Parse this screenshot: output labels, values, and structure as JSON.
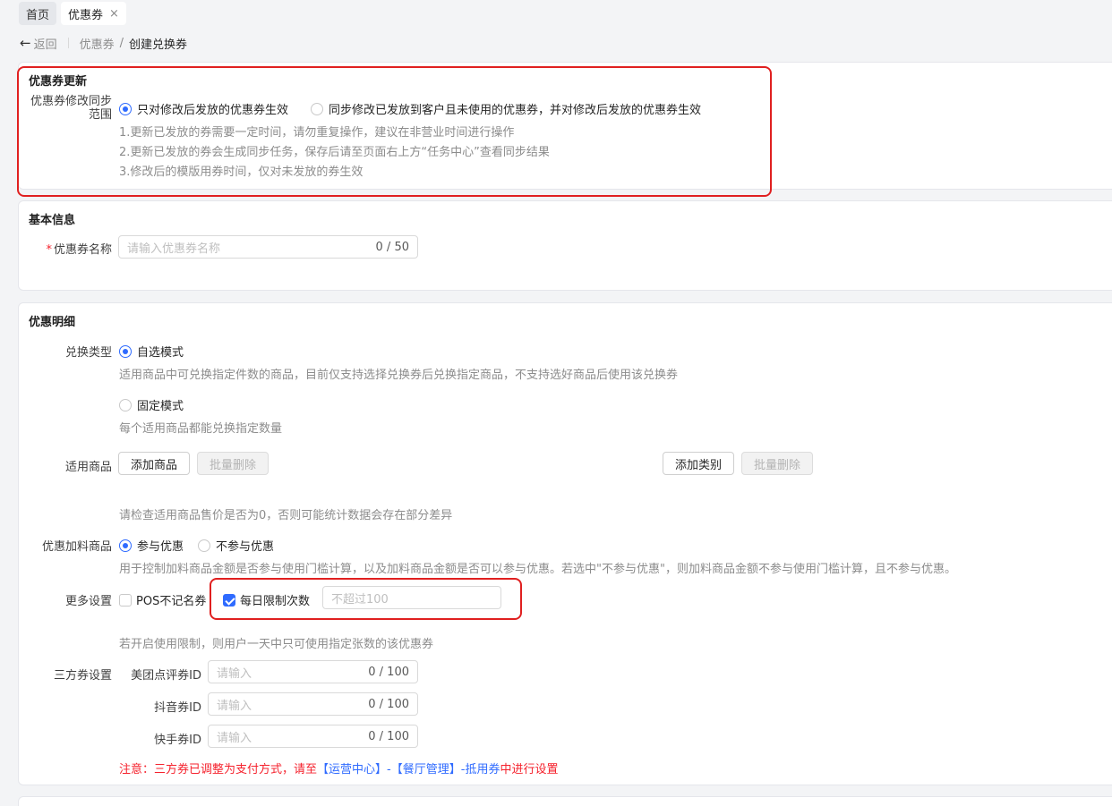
{
  "tabs": [
    {
      "label": "首页"
    },
    {
      "label": "优惠券",
      "close": "×"
    }
  ],
  "breadcrumb": {
    "back": "返回",
    "parent": "优惠券",
    "sep": "/",
    "current": "创建兑换券"
  },
  "sync": {
    "title": "优惠券更新",
    "label": "优惠券修改同步范围",
    "opt1": "只对修改后发放的优惠券生效",
    "opt2": "同步修改已发放到客户且未使用的优惠券，并对修改后发放的优惠券生效",
    "tips": [
      "1.更新已发放的券需要一定时间，请勿重复操作，建议在非营业时间进行操作",
      "2.更新已发放的券会生成同步任务，保存后请至页面右上方“任务中心”查看同步结果",
      "3.修改后的模版用券时间，仅对未发放的券生效"
    ]
  },
  "basic": {
    "title": "基本信息",
    "name_label": "优惠券名称",
    "required_mark": "*",
    "name_placeholder": "请输入优惠券名称",
    "name_count": "0 / 50"
  },
  "detail": {
    "title": "优惠明细",
    "type_label": "兑换类型",
    "type_opt1": "自选模式",
    "type_opt1_hint": "适用商品中可兑换指定件数的商品，目前仅支持选择兑换券后兑换指定商品，不支持选好商品后使用该兑换券",
    "type_opt2": "固定模式",
    "type_opt2_hint": "每个适用商品都能兑换指定数量",
    "goods_label": "适用商品",
    "add_goods": "添加商品",
    "batch_delete": "批量删除",
    "add_category": "添加类别",
    "batch_delete2": "批量删除",
    "goods_hint": "请检查适用商品售价是否为0，否则可能统计数据会存在部分差异",
    "addon_label": "优惠加料商品",
    "addon_opt1": "参与优惠",
    "addon_opt2": "不参与优惠",
    "addon_hint": "用于控制加料商品金额是否参与使用门槛计算，以及加料商品金额是否可以参与优惠。若选中\"不参与优惠\"，则加料商品金额不参与使用门槛计算，且不参与优惠。",
    "more_label": "更多设置",
    "pos_anon": "POS不记名券",
    "daily_limit": "每日限制次数",
    "daily_placeholder": "不超过100",
    "daily_hint": "若开启使用限制，则用户一天中只可使用指定张数的该优惠券",
    "third_label": "三方券设置",
    "third": [
      {
        "label": "美团点评券ID",
        "placeholder": "请输入",
        "count": "0 / 100"
      },
      {
        "label": "抖音券ID",
        "placeholder": "请输入",
        "count": "0 / 100"
      },
      {
        "label": "快手券ID",
        "placeholder": "请输入",
        "count": "0 / 100"
      }
    ],
    "notice": {
      "prefix": "注意：三方券已调整为支付方式，请至",
      "link1": "【运营中心】",
      "dash1": "-",
      "link2": "【餐厅管理】",
      "dash2": "-",
      "link3": "抵用券",
      "suffix": "中进行设置"
    }
  },
  "colors": {
    "accent": "#2f6bff",
    "highlight": "#e02020",
    "danger": "#f5222d"
  }
}
